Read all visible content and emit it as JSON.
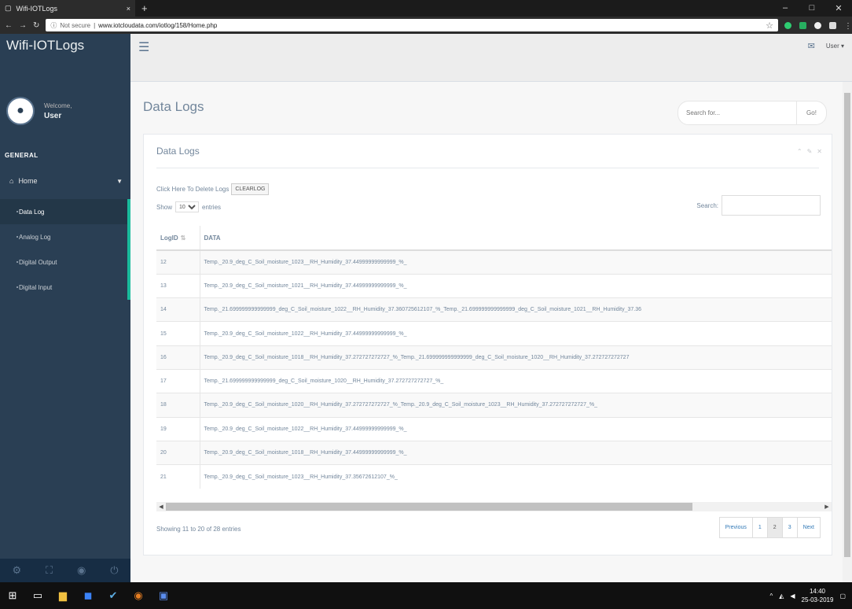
{
  "browser": {
    "tab_title": "Wifi-IOTLogs",
    "tab_close": "×",
    "new_tab": "+",
    "secure_label": "Not secure",
    "url": "www.iotcloudata.com/iotlog/158/Home.php",
    "win_min": "–",
    "win_max": "□",
    "win_close": "✕"
  },
  "brand": "Wifi-IOTLogs",
  "profile": {
    "welcome": "Welcome,",
    "name": "User"
  },
  "sidebar": {
    "section": "GENERAL",
    "home_label": "Home",
    "items": [
      {
        "label": "Data Log"
      },
      {
        "label": "Analog Log"
      },
      {
        "label": "Digital Output"
      },
      {
        "label": "Digital Input"
      }
    ]
  },
  "topnav": {
    "user_label": "User"
  },
  "page": {
    "title": "Data Logs",
    "search_placeholder": "Search for...",
    "search_button": "Go!"
  },
  "panel": {
    "title": "Data Logs",
    "delete_text": "Click Here To Delete Logs",
    "clear_button": "CLEARLOG",
    "show_label": "Show",
    "show_value": "10",
    "entries_label": "entries",
    "search_label": "Search:",
    "columns": {
      "id": "LogID",
      "data": "DATA"
    },
    "rows": [
      {
        "id": "12",
        "data": "Temp._20.9_deg_C_Soil_moisture_1023__RH_Humidity_37.44999999999999_%_"
      },
      {
        "id": "13",
        "data": "Temp._20.9_deg_C_Soil_moisture_1021__RH_Humidity_37.44999999999999_%_"
      },
      {
        "id": "14",
        "data": "Temp._21.699999999999999_deg_C_Soil_moisture_1022__RH_Humidity_37.360725612107_%_Temp._21.699999999999999_deg_C_Soil_moisture_1021__RH_Humidity_37.36"
      },
      {
        "id": "15",
        "data": "Temp._20.9_deg_C_Soil_moisture_1022__RH_Humidity_37.44999999999999_%_"
      },
      {
        "id": "16",
        "data": "Temp._20.9_deg_C_Soil_moisture_1018__RH_Humidity_37.272727272727_%_Temp._21.699999999999999_deg_C_Soil_moisture_1020__RH_Humidity_37.272727272727"
      },
      {
        "id": "17",
        "data": "Temp._21.699999999999999_deg_C_Soil_moisture_1020__RH_Humidity_37.272727272727_%_"
      },
      {
        "id": "18",
        "data": "Temp._20.9_deg_C_Soil_moisture_1020__RH_Humidity_37.272727272727_%_Temp._20.9_deg_C_Soil_moisture_1023__RH_Humidity_37.272727272727_%_"
      },
      {
        "id": "19",
        "data": "Temp._20.9_deg_C_Soil_moisture_1022__RH_Humidity_37.44999999999999_%_"
      },
      {
        "id": "20",
        "data": "Temp._20.9_deg_C_Soil_moisture_1018__RH_Humidity_37.44999999999999_%_"
      },
      {
        "id": "21",
        "data": "Temp._20.9_deg_C_Soil_moisture_1023__RH_Humidity_37.35672612107_%_"
      }
    ],
    "info": "Showing 11 to 20 of 28 entries",
    "pager": {
      "prev": "Previous",
      "p1": "1",
      "p2": "2",
      "p3": "3",
      "next": "Next"
    }
  },
  "taskbar": {
    "time": "14:40",
    "date": "25-03-2019"
  }
}
